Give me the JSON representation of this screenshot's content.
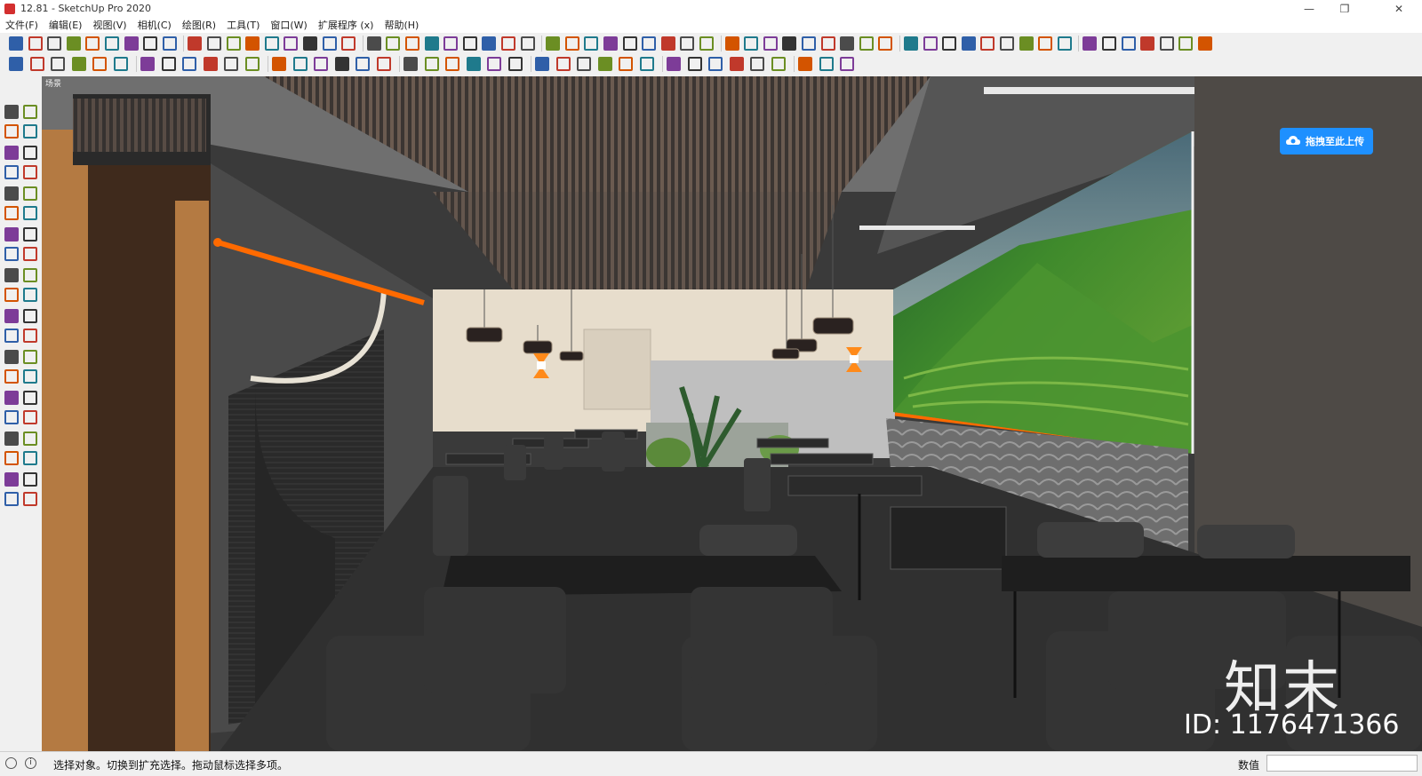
{
  "window": {
    "title": "12.81 - SketchUp Pro 2020",
    "minimize_glyph": "—",
    "maximize_glyph": "❐",
    "close_glyph": "✕"
  },
  "menu": {
    "items": [
      "文件(F)",
      "编辑(E)",
      "视图(V)",
      "相机(C)",
      "绘图(R)",
      "工具(T)",
      "窗口(W)",
      "扩展程序 (x)",
      "帮助(H)"
    ]
  },
  "toolbars": {
    "row1_icons": [
      "select-icon",
      "make-component-icon",
      "paint-bucket-icon",
      "eraser-icon",
      "line-icon",
      "freehand-icon",
      "rectangle-icon",
      "rotated-rectangle-icon",
      "circle-icon",
      "polygon-icon",
      "arc-icon",
      "two-point-arc-icon",
      "pie-icon",
      "three-point-arc-icon",
      "push-pull-icon",
      "follow-me-icon",
      "warehouse-icon",
      "component-icon",
      "house-icon",
      "layout-icon",
      "table-icon",
      "extension-icon",
      "model-icon",
      "tape-measure-icon",
      "dimension-icon",
      "protractor-icon",
      "text-icon",
      "axes-icon",
      "3d-text-icon",
      "sandbox-icon",
      "stair-icon",
      "ruler-icon",
      "chart-icon",
      "section-icon",
      "align-icon",
      "curve-icon",
      "joint-icon",
      "arch-icon",
      "loop-icon",
      "twist-icon",
      "layer-icon",
      "pencil-icon",
      "bow-icon",
      "split-icon",
      "rotate-icon",
      "lock-icon",
      "shape-icon",
      "brush-icon",
      "dome-icon",
      "wave-icon",
      "spiral-icon",
      "hook-icon",
      "comb-icon",
      "pillar-icon",
      "triangle-icon",
      "grid-icon",
      "book-icon",
      "dancer-icon",
      "broom-icon",
      "vray-icon",
      "render-icon"
    ],
    "row2_icons": [
      "xray-icon",
      "back-edges-icon",
      "wireframe-icon",
      "hidden-line-icon",
      "shaded-icon",
      "shaded-texture-icon",
      "monochrome-icon",
      "iso-icon",
      "top-view-icon",
      "front-view-icon",
      "right-view-icon",
      "back-view-icon",
      "left-view-icon",
      "section-plane-icon",
      "display-section-icon",
      "section-cut-icon",
      "section-fill-icon",
      "orbit-icon",
      "refresh-icon",
      "export-icon",
      "add-icon",
      "tree-icon",
      "terrain-icon",
      "checker-icon",
      "cloud-icon",
      "settings-icon",
      "mail-icon",
      "info-icon",
      "cloud-sync-icon",
      "cloud-search-icon",
      "cloud-up-icon",
      "cloud-down-icon",
      "frame-icon",
      "gear-icon",
      "badge-icon",
      "download-icon",
      "gear2-icon",
      "chrome-icon",
      "hex-icon"
    ]
  },
  "left_toolbar": {
    "icons": [
      "select-icon",
      "component-icon",
      "paint-bucket-icon",
      "eraser-icon",
      "line-icon",
      "freehand-icon",
      "rectangle-icon",
      "rotated-rectangle-icon",
      "circle-icon",
      "polygon-icon",
      "arc-icon",
      "two-point-arc-icon",
      "pie-icon",
      "three-point-arc-icon",
      "move-icon",
      "push-pull-icon",
      "rotate-icon",
      "follow-me-icon",
      "scale-icon",
      "offset-icon",
      "tape-measure-icon",
      "dimension-icon",
      "protractor-icon",
      "text-icon",
      "axes-icon",
      "3d-text-icon",
      "orbit-icon",
      "pan-icon",
      "zoom-icon",
      "zoom-window-icon",
      "zoom-extents-icon",
      "previous-view-icon",
      "position-camera-icon",
      "look-around-icon",
      "walk-icon",
      "section-plane-icon",
      "warehouse-icon",
      "extension-icon",
      "share-icon",
      "upload-icon"
    ]
  },
  "viewport": {
    "scene_label": "场景",
    "upload_button": "拖拽至此上传",
    "watermark_logo": "知末",
    "watermark_id": "ID: 1176471366"
  },
  "statusbar": {
    "info_icon": "i",
    "message": "选择对象。切换到扩充选择。拖动鼠标选择多项。",
    "measurements_label": "数值",
    "measurements_value": ""
  },
  "colors": {
    "accent_orange": "#ff6a00",
    "upload_blue": "#1e90ff",
    "wood": "#b47a42",
    "mural_green": "#3f8a2c"
  }
}
